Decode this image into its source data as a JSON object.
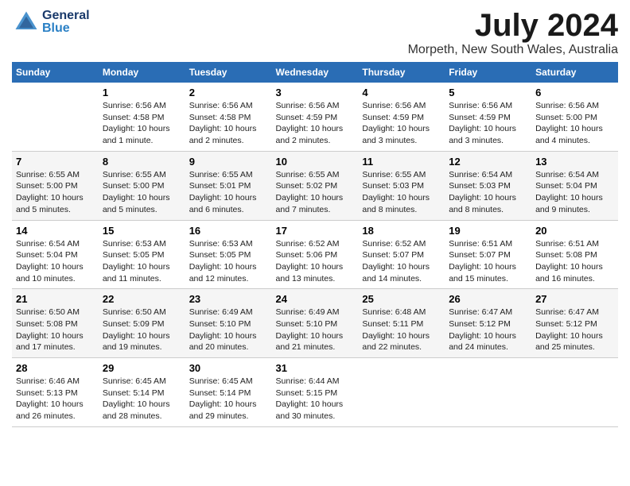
{
  "header": {
    "logo_general": "General",
    "logo_blue": "Blue",
    "main_title": "July 2024",
    "subtitle": "Morpeth, New South Wales, Australia"
  },
  "calendar": {
    "days_of_week": [
      "Sunday",
      "Monday",
      "Tuesday",
      "Wednesday",
      "Thursday",
      "Friday",
      "Saturday"
    ],
    "weeks": [
      [
        {
          "date": "",
          "sunrise": "",
          "sunset": "",
          "daylight": ""
        },
        {
          "date": "1",
          "sunrise": "Sunrise: 6:56 AM",
          "sunset": "Sunset: 4:58 PM",
          "daylight": "Daylight: 10 hours and 1 minute."
        },
        {
          "date": "2",
          "sunrise": "Sunrise: 6:56 AM",
          "sunset": "Sunset: 4:58 PM",
          "daylight": "Daylight: 10 hours and 2 minutes."
        },
        {
          "date": "3",
          "sunrise": "Sunrise: 6:56 AM",
          "sunset": "Sunset: 4:59 PM",
          "daylight": "Daylight: 10 hours and 2 minutes."
        },
        {
          "date": "4",
          "sunrise": "Sunrise: 6:56 AM",
          "sunset": "Sunset: 4:59 PM",
          "daylight": "Daylight: 10 hours and 3 minutes."
        },
        {
          "date": "5",
          "sunrise": "Sunrise: 6:56 AM",
          "sunset": "Sunset: 4:59 PM",
          "daylight": "Daylight: 10 hours and 3 minutes."
        },
        {
          "date": "6",
          "sunrise": "Sunrise: 6:56 AM",
          "sunset": "Sunset: 5:00 PM",
          "daylight": "Daylight: 10 hours and 4 minutes."
        }
      ],
      [
        {
          "date": "7",
          "sunrise": "Sunrise: 6:55 AM",
          "sunset": "Sunset: 5:00 PM",
          "daylight": "Daylight: 10 hours and 5 minutes."
        },
        {
          "date": "8",
          "sunrise": "Sunrise: 6:55 AM",
          "sunset": "Sunset: 5:00 PM",
          "daylight": "Daylight: 10 hours and 5 minutes."
        },
        {
          "date": "9",
          "sunrise": "Sunrise: 6:55 AM",
          "sunset": "Sunset: 5:01 PM",
          "daylight": "Daylight: 10 hours and 6 minutes."
        },
        {
          "date": "10",
          "sunrise": "Sunrise: 6:55 AM",
          "sunset": "Sunset: 5:02 PM",
          "daylight": "Daylight: 10 hours and 7 minutes."
        },
        {
          "date": "11",
          "sunrise": "Sunrise: 6:55 AM",
          "sunset": "Sunset: 5:03 PM",
          "daylight": "Daylight: 10 hours and 8 minutes."
        },
        {
          "date": "12",
          "sunrise": "Sunrise: 6:54 AM",
          "sunset": "Sunset: 5:03 PM",
          "daylight": "Daylight: 10 hours and 8 minutes."
        },
        {
          "date": "13",
          "sunrise": "Sunrise: 6:54 AM",
          "sunset": "Sunset: 5:04 PM",
          "daylight": "Daylight: 10 hours and 9 minutes."
        }
      ],
      [
        {
          "date": "14",
          "sunrise": "Sunrise: 6:54 AM",
          "sunset": "Sunset: 5:04 PM",
          "daylight": "Daylight: 10 hours and 10 minutes."
        },
        {
          "date": "15",
          "sunrise": "Sunrise: 6:53 AM",
          "sunset": "Sunset: 5:05 PM",
          "daylight": "Daylight: 10 hours and 11 minutes."
        },
        {
          "date": "16",
          "sunrise": "Sunrise: 6:53 AM",
          "sunset": "Sunset: 5:05 PM",
          "daylight": "Daylight: 10 hours and 12 minutes."
        },
        {
          "date": "17",
          "sunrise": "Sunrise: 6:52 AM",
          "sunset": "Sunset: 5:06 PM",
          "daylight": "Daylight: 10 hours and 13 minutes."
        },
        {
          "date": "18",
          "sunrise": "Sunrise: 6:52 AM",
          "sunset": "Sunset: 5:07 PM",
          "daylight": "Daylight: 10 hours and 14 minutes."
        },
        {
          "date": "19",
          "sunrise": "Sunrise: 6:51 AM",
          "sunset": "Sunset: 5:07 PM",
          "daylight": "Daylight: 10 hours and 15 minutes."
        },
        {
          "date": "20",
          "sunrise": "Sunrise: 6:51 AM",
          "sunset": "Sunset: 5:08 PM",
          "daylight": "Daylight: 10 hours and 16 minutes."
        }
      ],
      [
        {
          "date": "21",
          "sunrise": "Sunrise: 6:50 AM",
          "sunset": "Sunset: 5:08 PM",
          "daylight": "Daylight: 10 hours and 17 minutes."
        },
        {
          "date": "22",
          "sunrise": "Sunrise: 6:50 AM",
          "sunset": "Sunset: 5:09 PM",
          "daylight": "Daylight: 10 hours and 19 minutes."
        },
        {
          "date": "23",
          "sunrise": "Sunrise: 6:49 AM",
          "sunset": "Sunset: 5:10 PM",
          "daylight": "Daylight: 10 hours and 20 minutes."
        },
        {
          "date": "24",
          "sunrise": "Sunrise: 6:49 AM",
          "sunset": "Sunset: 5:10 PM",
          "daylight": "Daylight: 10 hours and 21 minutes."
        },
        {
          "date": "25",
          "sunrise": "Sunrise: 6:48 AM",
          "sunset": "Sunset: 5:11 PM",
          "daylight": "Daylight: 10 hours and 22 minutes."
        },
        {
          "date": "26",
          "sunrise": "Sunrise: 6:47 AM",
          "sunset": "Sunset: 5:12 PM",
          "daylight": "Daylight: 10 hours and 24 minutes."
        },
        {
          "date": "27",
          "sunrise": "Sunrise: 6:47 AM",
          "sunset": "Sunset: 5:12 PM",
          "daylight": "Daylight: 10 hours and 25 minutes."
        }
      ],
      [
        {
          "date": "28",
          "sunrise": "Sunrise: 6:46 AM",
          "sunset": "Sunset: 5:13 PM",
          "daylight": "Daylight: 10 hours and 26 minutes."
        },
        {
          "date": "29",
          "sunrise": "Sunrise: 6:45 AM",
          "sunset": "Sunset: 5:14 PM",
          "daylight": "Daylight: 10 hours and 28 minutes."
        },
        {
          "date": "30",
          "sunrise": "Sunrise: 6:45 AM",
          "sunset": "Sunset: 5:14 PM",
          "daylight": "Daylight: 10 hours and 29 minutes."
        },
        {
          "date": "31",
          "sunrise": "Sunrise: 6:44 AM",
          "sunset": "Sunset: 5:15 PM",
          "daylight": "Daylight: 10 hours and 30 minutes."
        },
        {
          "date": "",
          "sunrise": "",
          "sunset": "",
          "daylight": ""
        },
        {
          "date": "",
          "sunrise": "",
          "sunset": "",
          "daylight": ""
        },
        {
          "date": "",
          "sunrise": "",
          "sunset": "",
          "daylight": ""
        }
      ]
    ]
  }
}
